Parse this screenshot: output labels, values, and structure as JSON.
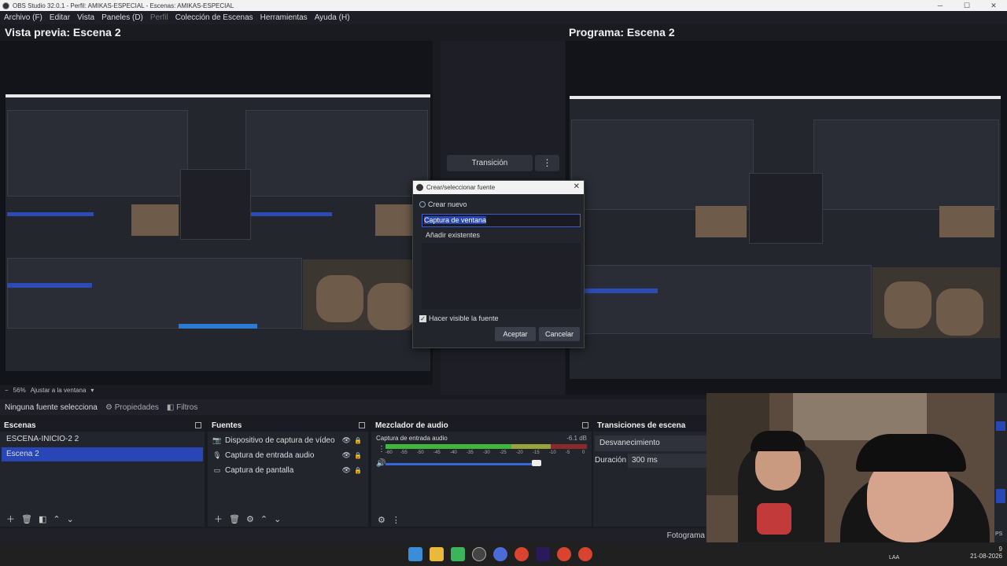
{
  "window": {
    "title": "OBS Studio 32.0.1 - Perfil: AMIKAS-ESPECIAL - Escenas: AMIKAS-ESPECIAL",
    "controls": [
      "─",
      "☐",
      "✕"
    ]
  },
  "menu": {
    "items": [
      "Archivo (F)",
      "Editar",
      "Vista",
      "Paneles (D)",
      "Perfil",
      "Colección de Escenas",
      "Herramientas",
      "Ayuda (H)"
    ]
  },
  "preview": {
    "left_title": "Vista previa: Escena 2",
    "right_title": "Programa: Escena 2"
  },
  "transition_panel": {
    "button": "Transición",
    "menu": "⋮"
  },
  "zoom": {
    "minus": "−",
    "level": "56%",
    "fit": "Ajustar a la ventana",
    "chevron": "▾"
  },
  "source_bar": {
    "label": "Ninguna fuente selecciona",
    "properties": "Propiedades",
    "filters": "Filtros"
  },
  "scenes": {
    "title": "Escenas",
    "items": [
      "ESCENA-INICIO-2 2",
      "Escena 2"
    ],
    "selected": 1
  },
  "sources": {
    "title": "Fuentes",
    "items": [
      {
        "label": "Dispositivo de captura de vídeo",
        "icon": "camera-icon"
      },
      {
        "label": "Captura de entrada audio",
        "icon": "microphone-icon"
      },
      {
        "label": "Captura de pantalla",
        "icon": "monitor-icon"
      }
    ]
  },
  "mixer": {
    "title": "Mezclador de audio",
    "channel": "Captura de entrada audio",
    "db": "-6.1 dB",
    "ticks": [
      "-60",
      "-55",
      "-50",
      "-45",
      "-40",
      "-35",
      "-30",
      "-25",
      "-20",
      "-15",
      "-10",
      "-5",
      "0"
    ],
    "level_db": -6.1
  },
  "transitions": {
    "title": "Transiciones de escena",
    "type": "Desvanecimiento",
    "duration_label": "Duración",
    "duration_value": "300 ms"
  },
  "status": {
    "frames": "Fotograma",
    "fps_suffix": "PS"
  },
  "dialog": {
    "title": "Crear/seleccionar fuente",
    "create_new": "Crear nuevo",
    "name_value": "Captura de ventana",
    "add_existing": "Añadir existentes",
    "visible_label": "Hacer visible la fuente",
    "accept": "Aceptar",
    "cancel": "Cancelar",
    "close": "✕"
  },
  "taskbar": {
    "lang": "LAA",
    "time": "9",
    "date": "21-08-2026"
  },
  "colors": {
    "accent": "#2846b6",
    "panel": "#23252d",
    "meter_green": "#3db83d",
    "meter_yellow": "#c8c83a",
    "meter_red": "#c83a3a"
  }
}
